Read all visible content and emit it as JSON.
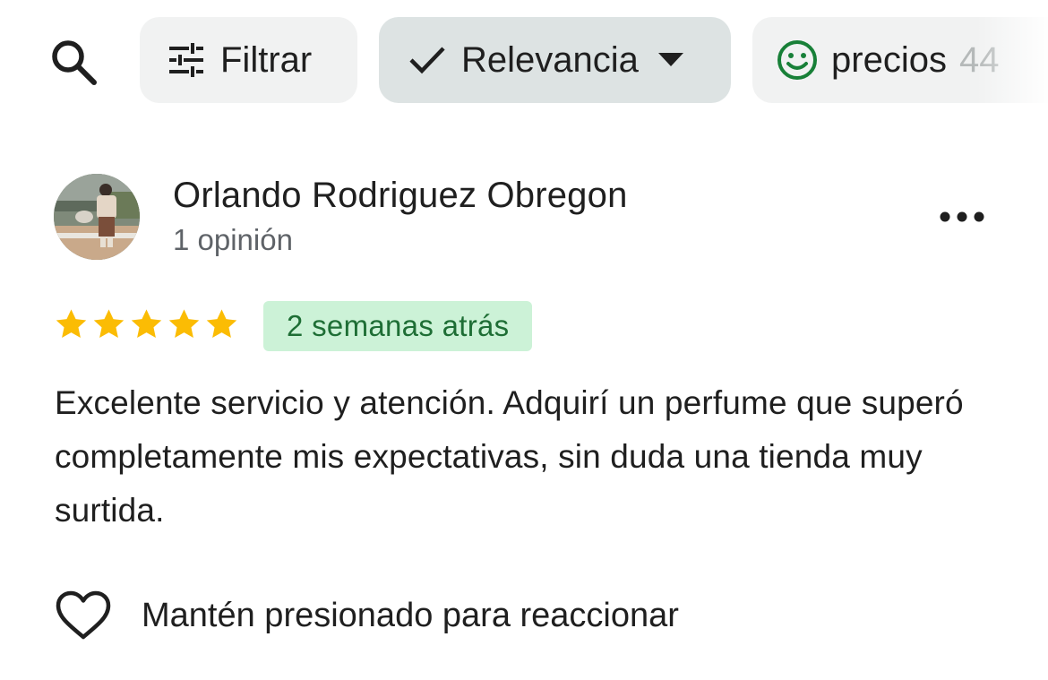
{
  "filters": {
    "search_icon": "search-icon",
    "filter_chip": {
      "label": "Filtrar",
      "icon": "tune-icon"
    },
    "sort_chip": {
      "label": "Relevancia",
      "icon": "check-icon",
      "dropdown_icon": "caret-down-icon"
    },
    "topic_chip": {
      "label": "precios",
      "count": "44",
      "icon": "smiley-icon"
    }
  },
  "review": {
    "author": "Orlando Rodriguez Obregon",
    "meta": "1 opinión",
    "rating": 5,
    "date_badge": "2 semanas atrás",
    "text": "Excelente servicio y atención. Adquirí un perfume que superó completamente mis expectativas, sin duda una tienda muy surtida.",
    "react_label": "Mantén presionado para reaccionar"
  },
  "colors": {
    "star": "#fbbc04",
    "badge_bg": "#ccf2d7",
    "badge_text": "#1e6e35",
    "smiley": "#188038",
    "chip_bg": "#f1f2f2",
    "chip_selected_bg": "#dde3e3"
  }
}
